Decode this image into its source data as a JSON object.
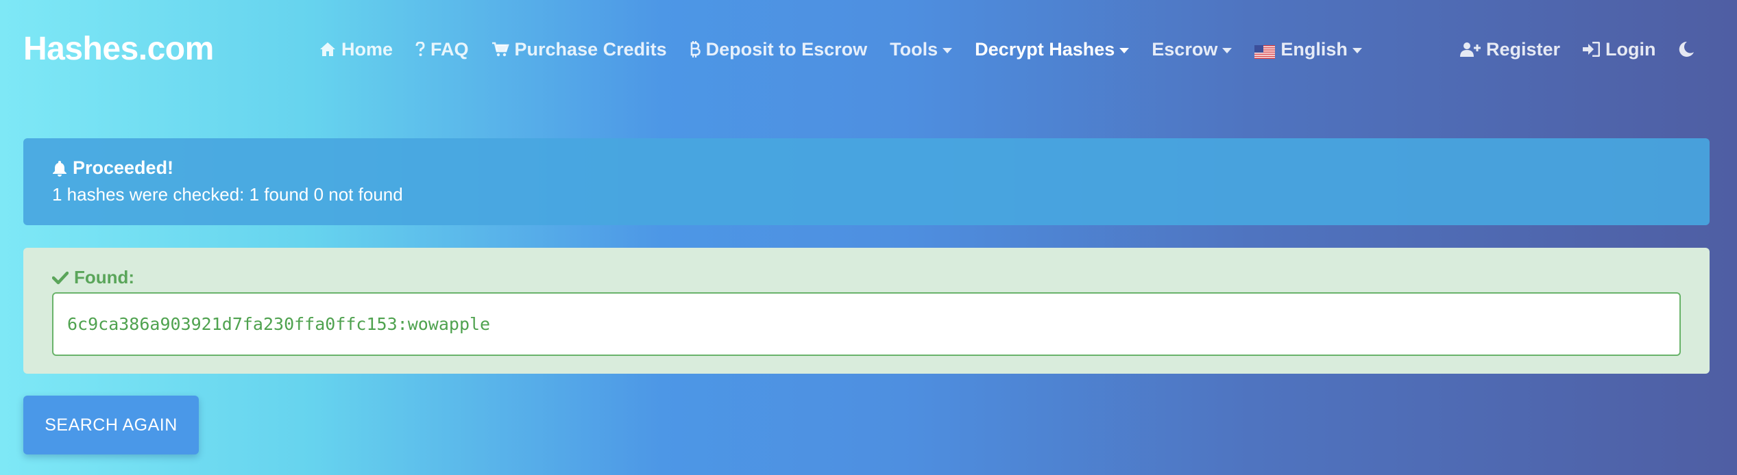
{
  "brand": "Hashes.com",
  "nav": {
    "home": {
      "label": "Home",
      "icon": "home-icon"
    },
    "faq": {
      "label": "FAQ",
      "icon": "question-icon"
    },
    "purchase": {
      "label": "Purchase Credits",
      "icon": "cart-icon"
    },
    "deposit": {
      "label": "Deposit to Escrow",
      "icon": "bitcoin-icon"
    },
    "tools": {
      "label": "Tools"
    },
    "decrypt": {
      "label": "Decrypt Hashes"
    },
    "escrow": {
      "label": "Escrow"
    },
    "language": {
      "label": "English",
      "icon": "us-flag-icon"
    },
    "register": {
      "label": "Register",
      "icon": "user-plus-icon"
    },
    "login": {
      "label": "Login",
      "icon": "sign-in-icon"
    },
    "theme_toggle": {
      "icon": "moon-icon"
    }
  },
  "alert": {
    "title": "Proceeded!",
    "icon": "bell-icon",
    "message": "1 hashes were checked: 1 found 0 not found"
  },
  "result": {
    "label": "Found:",
    "icon": "check-icon",
    "value": "6c9ca386a903921d7fa230ffa0ffc153:wowapple"
  },
  "actions": {
    "search_again": "SEARCH AGAIN"
  },
  "colors": {
    "gradient_start": "#7ee8f6",
    "gradient_mid": "#4d97e6",
    "gradient_end": "#4f5ea3",
    "info_alert": "#48a6e0",
    "success_bg": "#d9ecdc",
    "success_text": "#5aa55a",
    "button": "#4a98e8"
  }
}
